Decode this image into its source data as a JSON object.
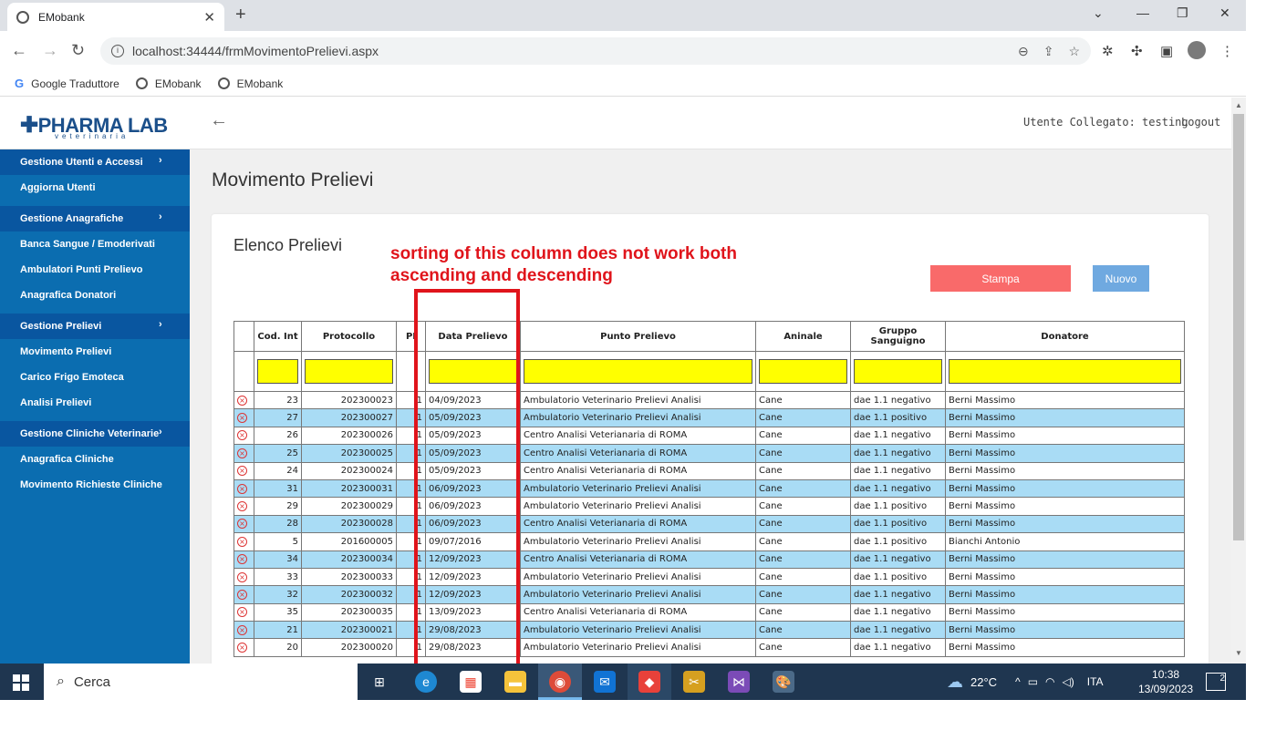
{
  "browser": {
    "tab_title": "EMobank",
    "url": "localhost:34444/frmMovimentoPrelievi.aspx",
    "bookmarks": [
      "Google Traduttore",
      "EMobank",
      "EMobank"
    ]
  },
  "header": {
    "logo": "PHARMA LAB",
    "logo_sub": "veterinaria",
    "user": "Utente Collegato: testing",
    "logout": "Logout"
  },
  "sidebar": [
    {
      "type": "group",
      "label": "Gestione Utenti e Accessi"
    },
    {
      "type": "item",
      "label": "Aggiorna Utenti"
    },
    {
      "type": "group",
      "label": "Gestione Anagrafiche"
    },
    {
      "type": "item",
      "label": "Banca Sangue / Emoderivati"
    },
    {
      "type": "item",
      "label": "Ambulatori Punti Prelievo"
    },
    {
      "type": "item",
      "label": "Anagrafica Donatori"
    },
    {
      "type": "group",
      "label": "Gestione Prelievi"
    },
    {
      "type": "item",
      "label": "Movimento Prelievi"
    },
    {
      "type": "item",
      "label": "Carico Frigo Emoteca"
    },
    {
      "type": "item",
      "label": "Analisi Prelievi"
    },
    {
      "type": "group",
      "label": "Gestione Cliniche Veterinarie"
    },
    {
      "type": "item",
      "label": "Anagrafica Cliniche"
    },
    {
      "type": "item",
      "label": "Movimento Richieste Cliniche"
    }
  ],
  "main": {
    "title": "Movimento Prelievi",
    "card_title": "Elenco Prelievi",
    "note": "sorting of this column does not work both\nascending and descending",
    "stampa": "Stampa",
    "nuovo": "Nuovo"
  },
  "grid": {
    "columns": [
      "",
      "Cod. Int",
      "Protocollo",
      "PI",
      "Data Prelievo",
      "Punto Prelievo",
      "Aninale",
      "Gruppo Sanguigno",
      "Donatore"
    ],
    "rows": [
      [
        "23",
        "202300023",
        "1",
        "04/09/2023",
        "Ambulatorio Veterinario Prelievi Analisi",
        "Cane",
        "dae 1.1 negativo",
        "Berni Massimo"
      ],
      [
        "27",
        "202300027",
        "1",
        "05/09/2023",
        "Ambulatorio Veterinario Prelievi Analisi",
        "Cane",
        "dae 1.1 positivo",
        "Berni Massimo"
      ],
      [
        "26",
        "202300026",
        "1",
        "05/09/2023",
        "Centro Analisi Veterianaria di ROMA",
        "Cane",
        "dae 1.1 negativo",
        "Berni Massimo"
      ],
      [
        "25",
        "202300025",
        "1",
        "05/09/2023",
        "Centro Analisi Veterianaria di ROMA",
        "Cane",
        "dae 1.1 negativo",
        "Berni Massimo"
      ],
      [
        "24",
        "202300024",
        "1",
        "05/09/2023",
        "Centro Analisi Veterianaria di ROMA",
        "Cane",
        "dae 1.1 negativo",
        "Berni Massimo"
      ],
      [
        "31",
        "202300031",
        "1",
        "06/09/2023",
        "Ambulatorio Veterinario Prelievi Analisi",
        "Cane",
        "dae 1.1 negativo",
        "Berni Massimo"
      ],
      [
        "29",
        "202300029",
        "1",
        "06/09/2023",
        "Ambulatorio Veterinario Prelievi Analisi",
        "Cane",
        "dae 1.1 positivo",
        "Berni Massimo"
      ],
      [
        "28",
        "202300028",
        "1",
        "06/09/2023",
        "Centro Analisi Veterianaria di ROMA",
        "Cane",
        "dae 1.1 positivo",
        "Berni Massimo"
      ],
      [
        "5",
        "201600005",
        "1",
        "09/07/2016",
        "Ambulatorio Veterinario Prelievi Analisi",
        "Cane",
        "dae 1.1 positivo",
        "Bianchi Antonio"
      ],
      [
        "34",
        "202300034",
        "1",
        "12/09/2023",
        "Centro Analisi Veterianaria di ROMA",
        "Cane",
        "dae 1.1 negativo",
        "Berni Massimo"
      ],
      [
        "33",
        "202300033",
        "1",
        "12/09/2023",
        "Ambulatorio Veterinario Prelievi Analisi",
        "Cane",
        "dae 1.1 positivo",
        "Berni Massimo"
      ],
      [
        "32",
        "202300032",
        "1",
        "12/09/2023",
        "Ambulatorio Veterinario Prelievi Analisi",
        "Cane",
        "dae 1.1 negativo",
        "Berni Massimo"
      ],
      [
        "35",
        "202300035",
        "1",
        "13/09/2023",
        "Centro Analisi Veterianaria di ROMA",
        "Cane",
        "dae 1.1 negativo",
        "Berni Massimo"
      ],
      [
        "21",
        "202300021",
        "1",
        "29/08/2023",
        "Ambulatorio Veterinario Prelievi Analisi",
        "Cane",
        "dae 1.1 negativo",
        "Berni Massimo"
      ],
      [
        "20",
        "202300020",
        "1",
        "29/08/2023",
        "Ambulatorio Veterinario Prelievi Analisi",
        "Cane",
        "dae 1.1 negativo",
        "Berni Massimo"
      ]
    ]
  },
  "taskbar": {
    "search": "Cerca",
    "weather": "22°C",
    "lang": "ITA",
    "time": "10:38",
    "date": "13/09/2023",
    "notifications": "2"
  }
}
